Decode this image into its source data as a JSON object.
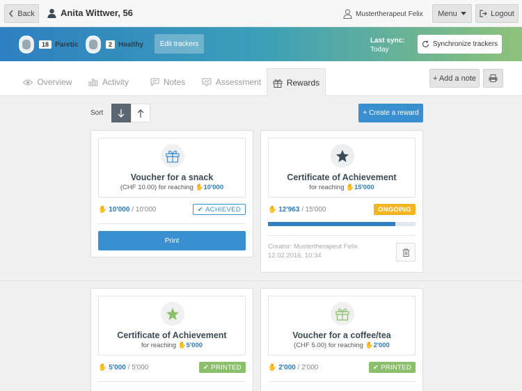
{
  "header": {
    "back_label": "Back",
    "patient_name": "Anita Wittwer, 56",
    "therapist_name": "Mustertherapeut Felix",
    "menu_label": "Menu",
    "logout_label": "Logout"
  },
  "trackers": {
    "paretic_count": "18",
    "paretic_label": "Paretic",
    "healthy_count": "2",
    "healthy_label": "Healthy",
    "edit_label": "Edit trackers",
    "last_sync_label": "Last sync:",
    "last_sync_value": "Today",
    "sync_button_label": "Synchronize trackers"
  },
  "tabs": [
    {
      "label": "Overview"
    },
    {
      "label": "Activity"
    },
    {
      "label": "Notes"
    },
    {
      "label": "Assessment"
    },
    {
      "label": "Rewards"
    }
  ],
  "actions": {
    "add_note_label": "+ Add a note",
    "sort_label": "Sort",
    "create_reward_label": "+ Create a reward"
  },
  "rewards": [
    {
      "icon": "gift-icon",
      "title": "Voucher for a snack",
      "subtitle": "(CHF 10.00) for reaching",
      "target": "10'000",
      "current": "10'000",
      "total": "/ 10'000",
      "status": "ACHIEVED",
      "print_label": "Print"
    },
    {
      "icon": "star-icon",
      "title": "Certificate of Achievement",
      "subtitle": "for reaching",
      "target": "15'000",
      "current": "12'963",
      "total": "/ 15'000",
      "status": "ONGOING",
      "progress": 0.864,
      "creator": "Creator: Mustertherapeut Felix",
      "date": "12.02.2016, 10:34"
    },
    {
      "icon": "star-icon",
      "title": "Certificate of Achievement",
      "subtitle": "for reaching",
      "target": "5'000",
      "current": "5'000",
      "total": "/ 5'000",
      "status": "PRINTED"
    },
    {
      "icon": "gift-icon",
      "title": "Voucher for a coffee/tea",
      "subtitle": "(CHF 5.00) for reaching",
      "target": "2'000",
      "current": "2'000",
      "total": "/ 2'000",
      "status": "PRINTED"
    }
  ],
  "colors": {
    "primary": "#3a8fd0",
    "ongoing": "#f3b521",
    "printed": "#8cbf6c"
  }
}
